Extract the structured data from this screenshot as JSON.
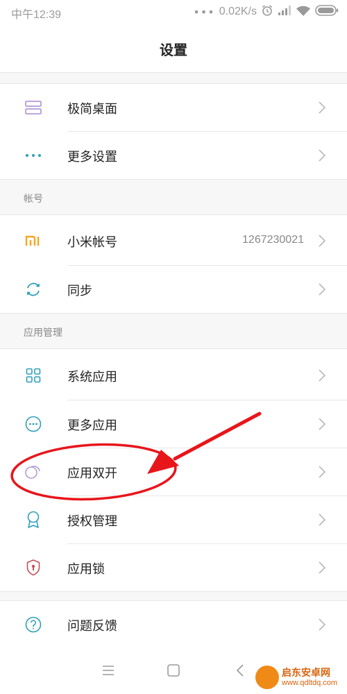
{
  "status": {
    "time": "中午12:39",
    "dots": "•••",
    "speed": "0.02K/s"
  },
  "header": {
    "title": "设置"
  },
  "rows": {
    "minimal_desktop": {
      "label": "极简桌面",
      "icon": "desktop-layout-icon"
    },
    "more_settings": {
      "label": "更多设置",
      "icon": "more-dots-icon"
    },
    "mi_account": {
      "label": "小米帐号",
      "value": "1267230021",
      "icon": "mi-logo-icon"
    },
    "sync": {
      "label": "同步",
      "icon": "sync-icon"
    },
    "system_apps": {
      "label": "系统应用",
      "icon": "grid-apps-icon"
    },
    "more_apps": {
      "label": "更多应用",
      "icon": "more-circle-icon"
    },
    "dual_apps": {
      "label": "应用双开",
      "icon": "dual-apps-icon"
    },
    "permissions": {
      "label": "授权管理",
      "icon": "badge-icon"
    },
    "app_lock": {
      "label": "应用锁",
      "icon": "shield-icon"
    },
    "feedback": {
      "label": "问题反馈",
      "icon": "question-icon"
    }
  },
  "sections": {
    "account": "帐号",
    "app_management": "应用管理"
  },
  "watermark": {
    "name": "启东安卓网",
    "url": "www.qdltdq.com"
  },
  "colors": {
    "accent_teal": "#2e9fb8",
    "mi_orange": "#f5a623",
    "purple": "#b59ad6",
    "lock_red": "#c4505a",
    "annotation_red": "#e8151b"
  }
}
